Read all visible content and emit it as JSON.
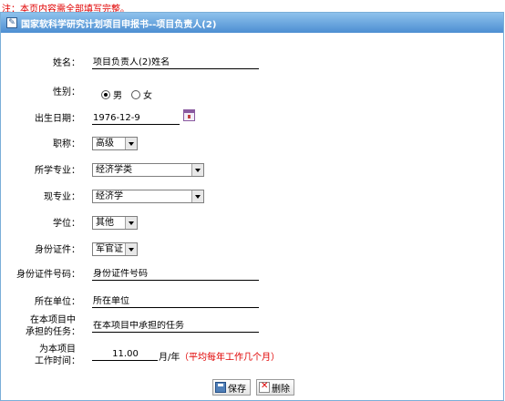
{
  "notice": "注：本页内容需全部填写完整。",
  "panel_title": "国家软科学研究计划项目申报书--项目负责人(2)",
  "fields": {
    "name": {
      "label": "姓名：",
      "value": "项目负责人(2)姓名"
    },
    "gender": {
      "label": "性别：",
      "options": [
        "男",
        "女"
      ],
      "selected": "男"
    },
    "birth": {
      "label": "出生日期：",
      "value": "1976-12-9"
    },
    "title": {
      "label": "职称：",
      "value": "高级"
    },
    "major_studied": {
      "label": "所学专业：",
      "value": "经济学类"
    },
    "current_major": {
      "label": "现专业：",
      "value": "经济学"
    },
    "degree": {
      "label": "学位：",
      "value": "其他"
    },
    "id_type": {
      "label": "身份证件：",
      "value": "军官证"
    },
    "id_number": {
      "label": "身份证件号码：",
      "value": "身份证件号码"
    },
    "organization": {
      "label": "所在单位：",
      "value": "所在单位"
    },
    "task": {
      "label_line1": "在本项目中",
      "label_line2": "承担的任务：",
      "value": "在本项目中承担的任务"
    },
    "work_time": {
      "label_line1": "为本项目",
      "label_line2": "工作时间：",
      "value": "11.00",
      "unit": "月/年",
      "hint": "（平均每年工作几个月）"
    }
  },
  "buttons": {
    "save": "保存",
    "delete": "删除"
  }
}
